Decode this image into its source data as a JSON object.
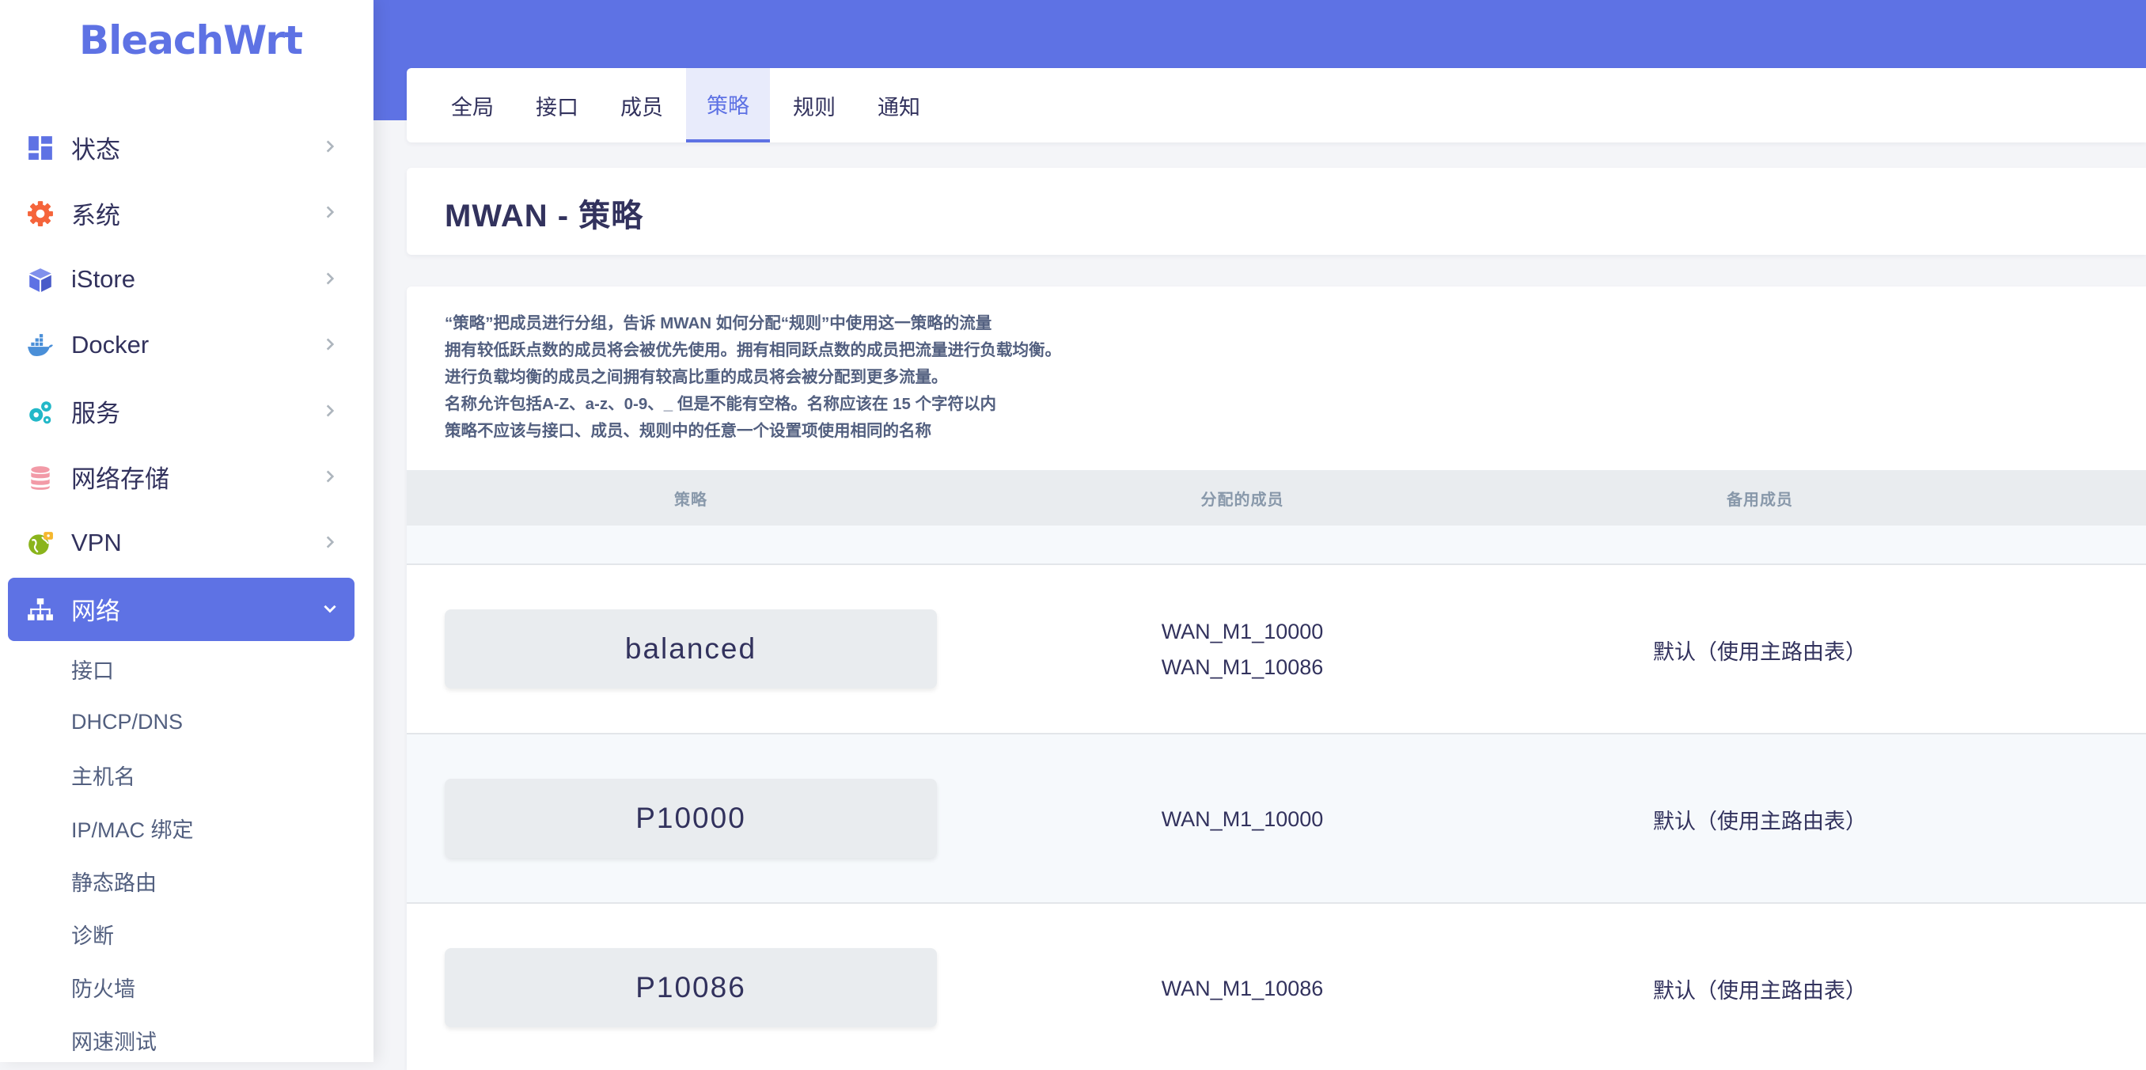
{
  "app": {
    "logo": "BleachWrt"
  },
  "sidebar": {
    "items": [
      {
        "label": "状态",
        "icon": "dashboard-icon"
      },
      {
        "label": "系统",
        "icon": "gear-icon"
      },
      {
        "label": "iStore",
        "icon": "cube-icon"
      },
      {
        "label": "Docker",
        "icon": "docker-icon"
      },
      {
        "label": "服务",
        "icon": "cogs-icon"
      },
      {
        "label": "网络存储",
        "icon": "database-icon"
      },
      {
        "label": "VPN",
        "icon": "globe-lock-icon"
      },
      {
        "label": "网络",
        "icon": "sitemap-icon"
      }
    ],
    "network_submenu": [
      "接口",
      "DHCP/DNS",
      "主机名",
      "IP/MAC 绑定",
      "静态路由",
      "诊断",
      "防火墙",
      "网速测试"
    ]
  },
  "tabs": [
    "全局",
    "接口",
    "成员",
    "策略",
    "规则",
    "通知"
  ],
  "active_tab": "策略",
  "page": {
    "title": "MWAN - 策略",
    "description": [
      "“策略”把成员进行分组，告诉 MWAN 如何分配“规则”中使用这一策略的流量",
      "拥有较低跃点数的成员将会被优先使用。拥有相同跃点数的成员把流量进行负载均衡。",
      "进行负载均衡的成员之间拥有较高比重的成员将会被分配到更多流量。",
      "名称允许包括A-Z、a-z、0-9、_ 但是不能有空格。名称应该在 15 个字符以内",
      "策略不应该与接口、成员、规则中的任意一个设置项使用相同的名称"
    ]
  },
  "table": {
    "headers": {
      "policy": "策略",
      "assigned_members": "分配的成员",
      "backup_member": "备用成员"
    },
    "rows": [
      {
        "name": "balanced",
        "member_1": "WAN_M1_10000",
        "member_2": "WAN_M1_10086",
        "backup": "默认（使用主路由表）"
      },
      {
        "name": "P10000",
        "member_1": "WAN_M1_10000",
        "member_2": "",
        "backup": "默认（使用主路由表）"
      },
      {
        "name": "P10086",
        "member_1": "WAN_M1_10086",
        "member_2": "",
        "backup": "默认（使用主路由表）"
      }
    ]
  },
  "colors": {
    "accent": "#5e72e4",
    "system_icon": "#f5643b",
    "istore_icon": "#5e72e4",
    "docker_icon": "#4a8fd8",
    "service_icon": "#23b8c8",
    "storage_icon": "#f29aa7",
    "vpn_icon": "#8ab41c"
  }
}
